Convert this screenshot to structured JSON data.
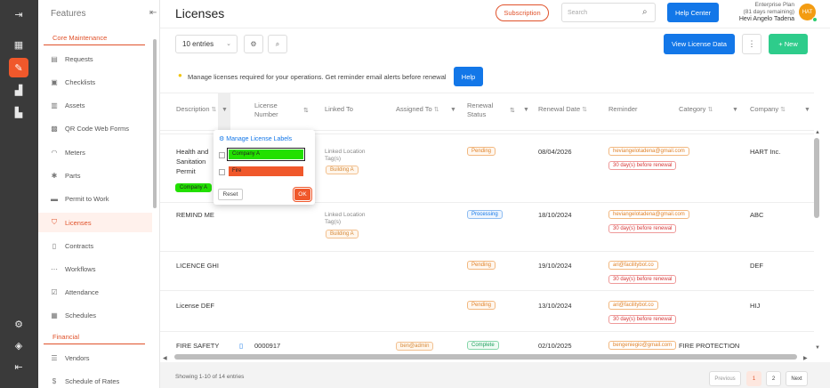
{
  "sidebar": {
    "heading": "Features",
    "sections": [
      "Core Maintenance",
      "Financial"
    ],
    "items": [
      {
        "label": "Requests",
        "icon": "request-icon"
      },
      {
        "label": "Checklists",
        "icon": "checklist-icon"
      },
      {
        "label": "Assets",
        "icon": "asset-icon"
      },
      {
        "label": "QR Code Web Forms",
        "icon": "qr-icon"
      },
      {
        "label": "Meters",
        "icon": "meter-icon"
      },
      {
        "label": "Parts",
        "icon": "parts-icon"
      },
      {
        "label": "Permit to Work",
        "icon": "permit-icon"
      },
      {
        "label": "Licenses",
        "icon": "license-icon"
      },
      {
        "label": "Contracts",
        "icon": "contract-icon"
      },
      {
        "label": "Workflows",
        "icon": "workflow-icon"
      },
      {
        "label": "Attendance",
        "icon": "attendance-icon"
      },
      {
        "label": "Schedules",
        "icon": "schedule-icon"
      },
      {
        "label": "Vendors",
        "icon": "vendor-icon"
      },
      {
        "label": "Schedule of Rates",
        "icon": "rates-icon"
      }
    ]
  },
  "header": {
    "title": "Licenses",
    "subscription": "Subscription",
    "search_placeholder": "Search",
    "help_center": "Help Center",
    "plan": "Enterprise Plan",
    "plan_remaining": "(81 days remaining)",
    "user_name": "Hevi Angelo Tadena",
    "avatar_initials": "HAT"
  },
  "toolbar": {
    "entries": "10 entries",
    "view_license_data": "View License Data",
    "new_label": "+ New"
  },
  "banner": {
    "text": "Manage licenses required for your operations. Get reminder email alerts before renewal",
    "help": "Help"
  },
  "columns": {
    "description": "Description",
    "license_number_1": "License",
    "license_number_2": "Number",
    "linked_to": "Linked To",
    "assigned_to": "Assigned To",
    "renewal_status_1": "Renewal",
    "renewal_status_2": "Status",
    "renewal_date": "Renewal Date",
    "reminder": "Reminder",
    "category": "Category",
    "company": "Company"
  },
  "rows": [
    {
      "desc1": "Health and",
      "desc2": "Sanitation",
      "desc3": "Permit",
      "label": "Company A",
      "linked1": "Linked Location",
      "linked2": "Tag(s)",
      "location": "Building A",
      "status": "Pending",
      "date": "08/04/2026",
      "email": "heviangelotadena@gmail.com",
      "reminder": "30 day(s) before renewal",
      "company": "HART Inc."
    },
    {
      "desc1": "REMIND ME",
      "linked1": "Linked Location",
      "linked2": "Tag(s)",
      "location": "Building A",
      "status": "Processing",
      "date": "18/10/2024",
      "email": "heviangelotadena@gmail.com",
      "reminder": "30 day(s) before renewal",
      "company": "ABC"
    },
    {
      "desc1": "LICENCE GHI",
      "status": "Pending",
      "date": "19/10/2024",
      "email": "ari@facilitybot.co",
      "reminder": "30 day(s) before renewal",
      "company": "DEF"
    },
    {
      "desc1": "License DEF",
      "status": "Pending",
      "date": "13/10/2024",
      "email": "ari@facilitybot.co",
      "reminder": "30 day(s) before renewal",
      "company": "HIJ"
    },
    {
      "desc1": "FIRE SAFETY",
      "license_number": "0000917",
      "assigned": "ben@admin",
      "status": "Complete",
      "date": "02/10/2025",
      "email": "bengeniegio@gmail.com",
      "category": "FIRE PROTECTION"
    }
  ],
  "popover": {
    "title": "Manage License Labels",
    "labels": [
      {
        "name": "Company A",
        "color": "#22e000"
      },
      {
        "name": "Fire",
        "color": "#f0582b"
      }
    ],
    "reset": "Reset",
    "ok": "OK"
  },
  "footer": {
    "showing": "Showing 1-10 of 14 entries",
    "previous": "Previous",
    "page1": "1",
    "page2": "2",
    "next": "Next"
  },
  "colors": {
    "accent": "#f0582b",
    "primary": "#1377e8",
    "success": "#2ecc8b"
  }
}
